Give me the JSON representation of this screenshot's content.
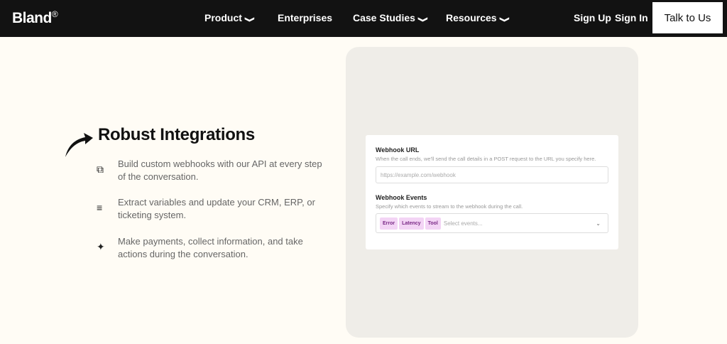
{
  "nav": {
    "logo": "Bland",
    "logo_mark": "®",
    "items": [
      {
        "label": "Product",
        "dropdown": true
      },
      {
        "label": "Enterprises",
        "dropdown": false
      },
      {
        "label": "Case Studies",
        "dropdown": true
      },
      {
        "label": "Resources",
        "dropdown": true
      }
    ],
    "sign_up": "Sign Up",
    "sign_in": "Sign In",
    "cta": "Talk to Us"
  },
  "section": {
    "title": "Robust Integrations",
    "features": [
      {
        "icon": "copy-icon",
        "text": "Build custom webhooks with our API at every step of the conversation."
      },
      {
        "icon": "sliders-icon",
        "text": "Extract variables and update your CRM, ERP, or ticketing system."
      },
      {
        "icon": "magic-wand-icon",
        "text": "Make payments, collect information, and take actions during the conversation."
      }
    ]
  },
  "card": {
    "url_label": "Webhook URL",
    "url_desc": "When the call ends, we'll send the call details in a POST request to the URL you specify here.",
    "url_placeholder": "https://example.com/webhook",
    "events_label": "Webhook Events",
    "events_desc": "Specify which events to stream to the webhook during the call.",
    "tags": [
      "Error",
      "Latency",
      "Tool"
    ],
    "events_placeholder": "Select events..."
  }
}
